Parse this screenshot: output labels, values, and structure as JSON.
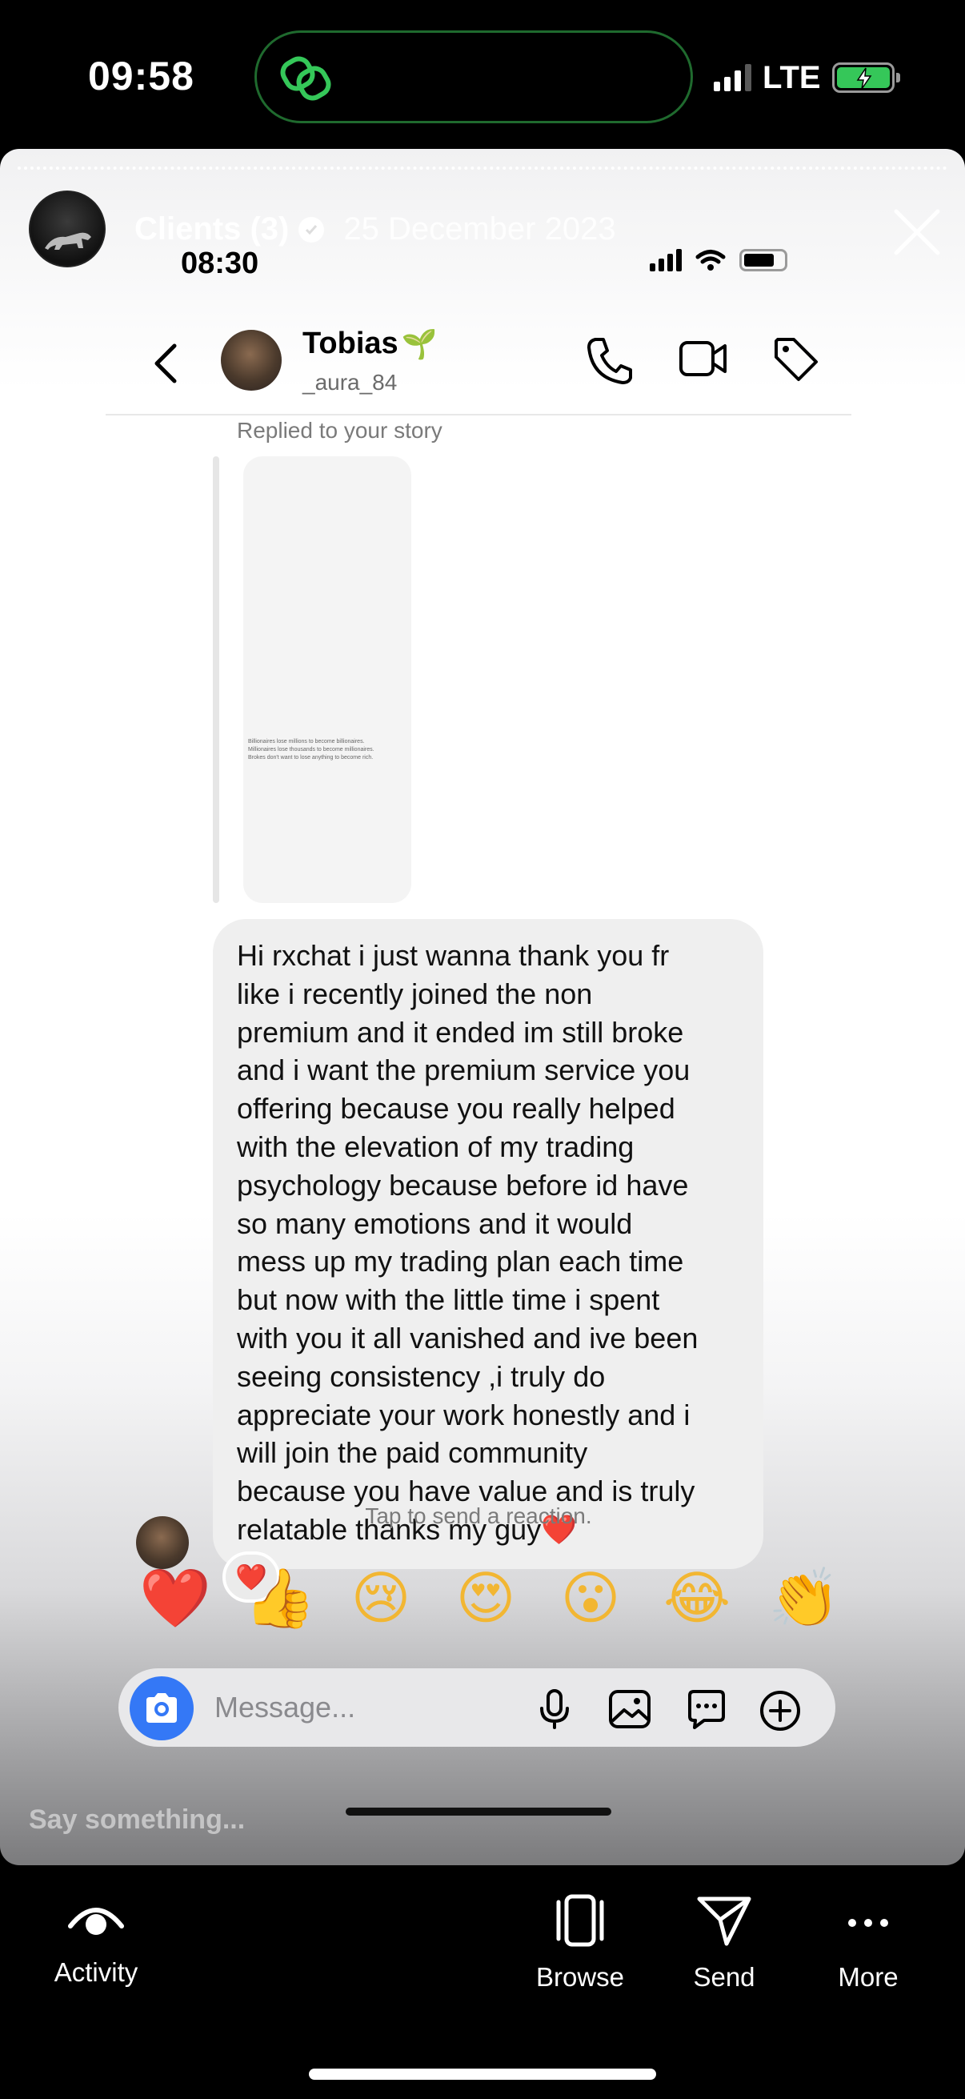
{
  "system_status": {
    "time": "09:58",
    "network": "LTE"
  },
  "story": {
    "title": "Clients (3)",
    "date": "25 December 2023",
    "reply_placeholder": "Say something..."
  },
  "screenshot": {
    "status_time": "08:30",
    "contact": {
      "name": "Tobias",
      "name_emoji": "🌱",
      "handle": "_aura_84"
    },
    "replied_label": "Replied to your story",
    "story_preview_lines": [
      "Billionaires lose millions to become billionaires.",
      "Millionaires lose thousands to become millionaires.",
      "Brokes don't want to lose anything to become rich."
    ],
    "message_lines": [
      "Hi rxchat i just wanna thank you fr",
      "like i recently joined the non",
      "premium and it ended im still broke",
      "and i want the premium service you",
      "offering because you really helped",
      "with the elevation of my trading",
      "psychology because before id have",
      "so many emotions and it would",
      "mess up my trading plan each time",
      "but now with the little time i spent",
      "with you it all vanished and ive been",
      "seeing consistency ,i truly do",
      "appreciate your work honestly and i",
      "will join the paid community",
      "because you have value and is truly",
      "relatable thanks my guy❤️"
    ],
    "reaction": "❤️",
    "tap_hint": "Tap to send a reaction.",
    "quick_reactions": [
      "❤️",
      "👍",
      "😢",
      "😍",
      "😮",
      "😂",
      "👏"
    ],
    "composer_placeholder": "Message..."
  },
  "bottom_nav": [
    {
      "label": "Activity",
      "icon": "activity-eye-icon"
    },
    {
      "label": "Browse",
      "icon": "browse-icon"
    },
    {
      "label": "Send",
      "icon": "send-icon"
    },
    {
      "label": "More",
      "icon": "more-icon"
    }
  ],
  "colors": {
    "accent_blue": "#3478f6",
    "island_green": "#35c759",
    "bubble_grey": "#efefef"
  }
}
